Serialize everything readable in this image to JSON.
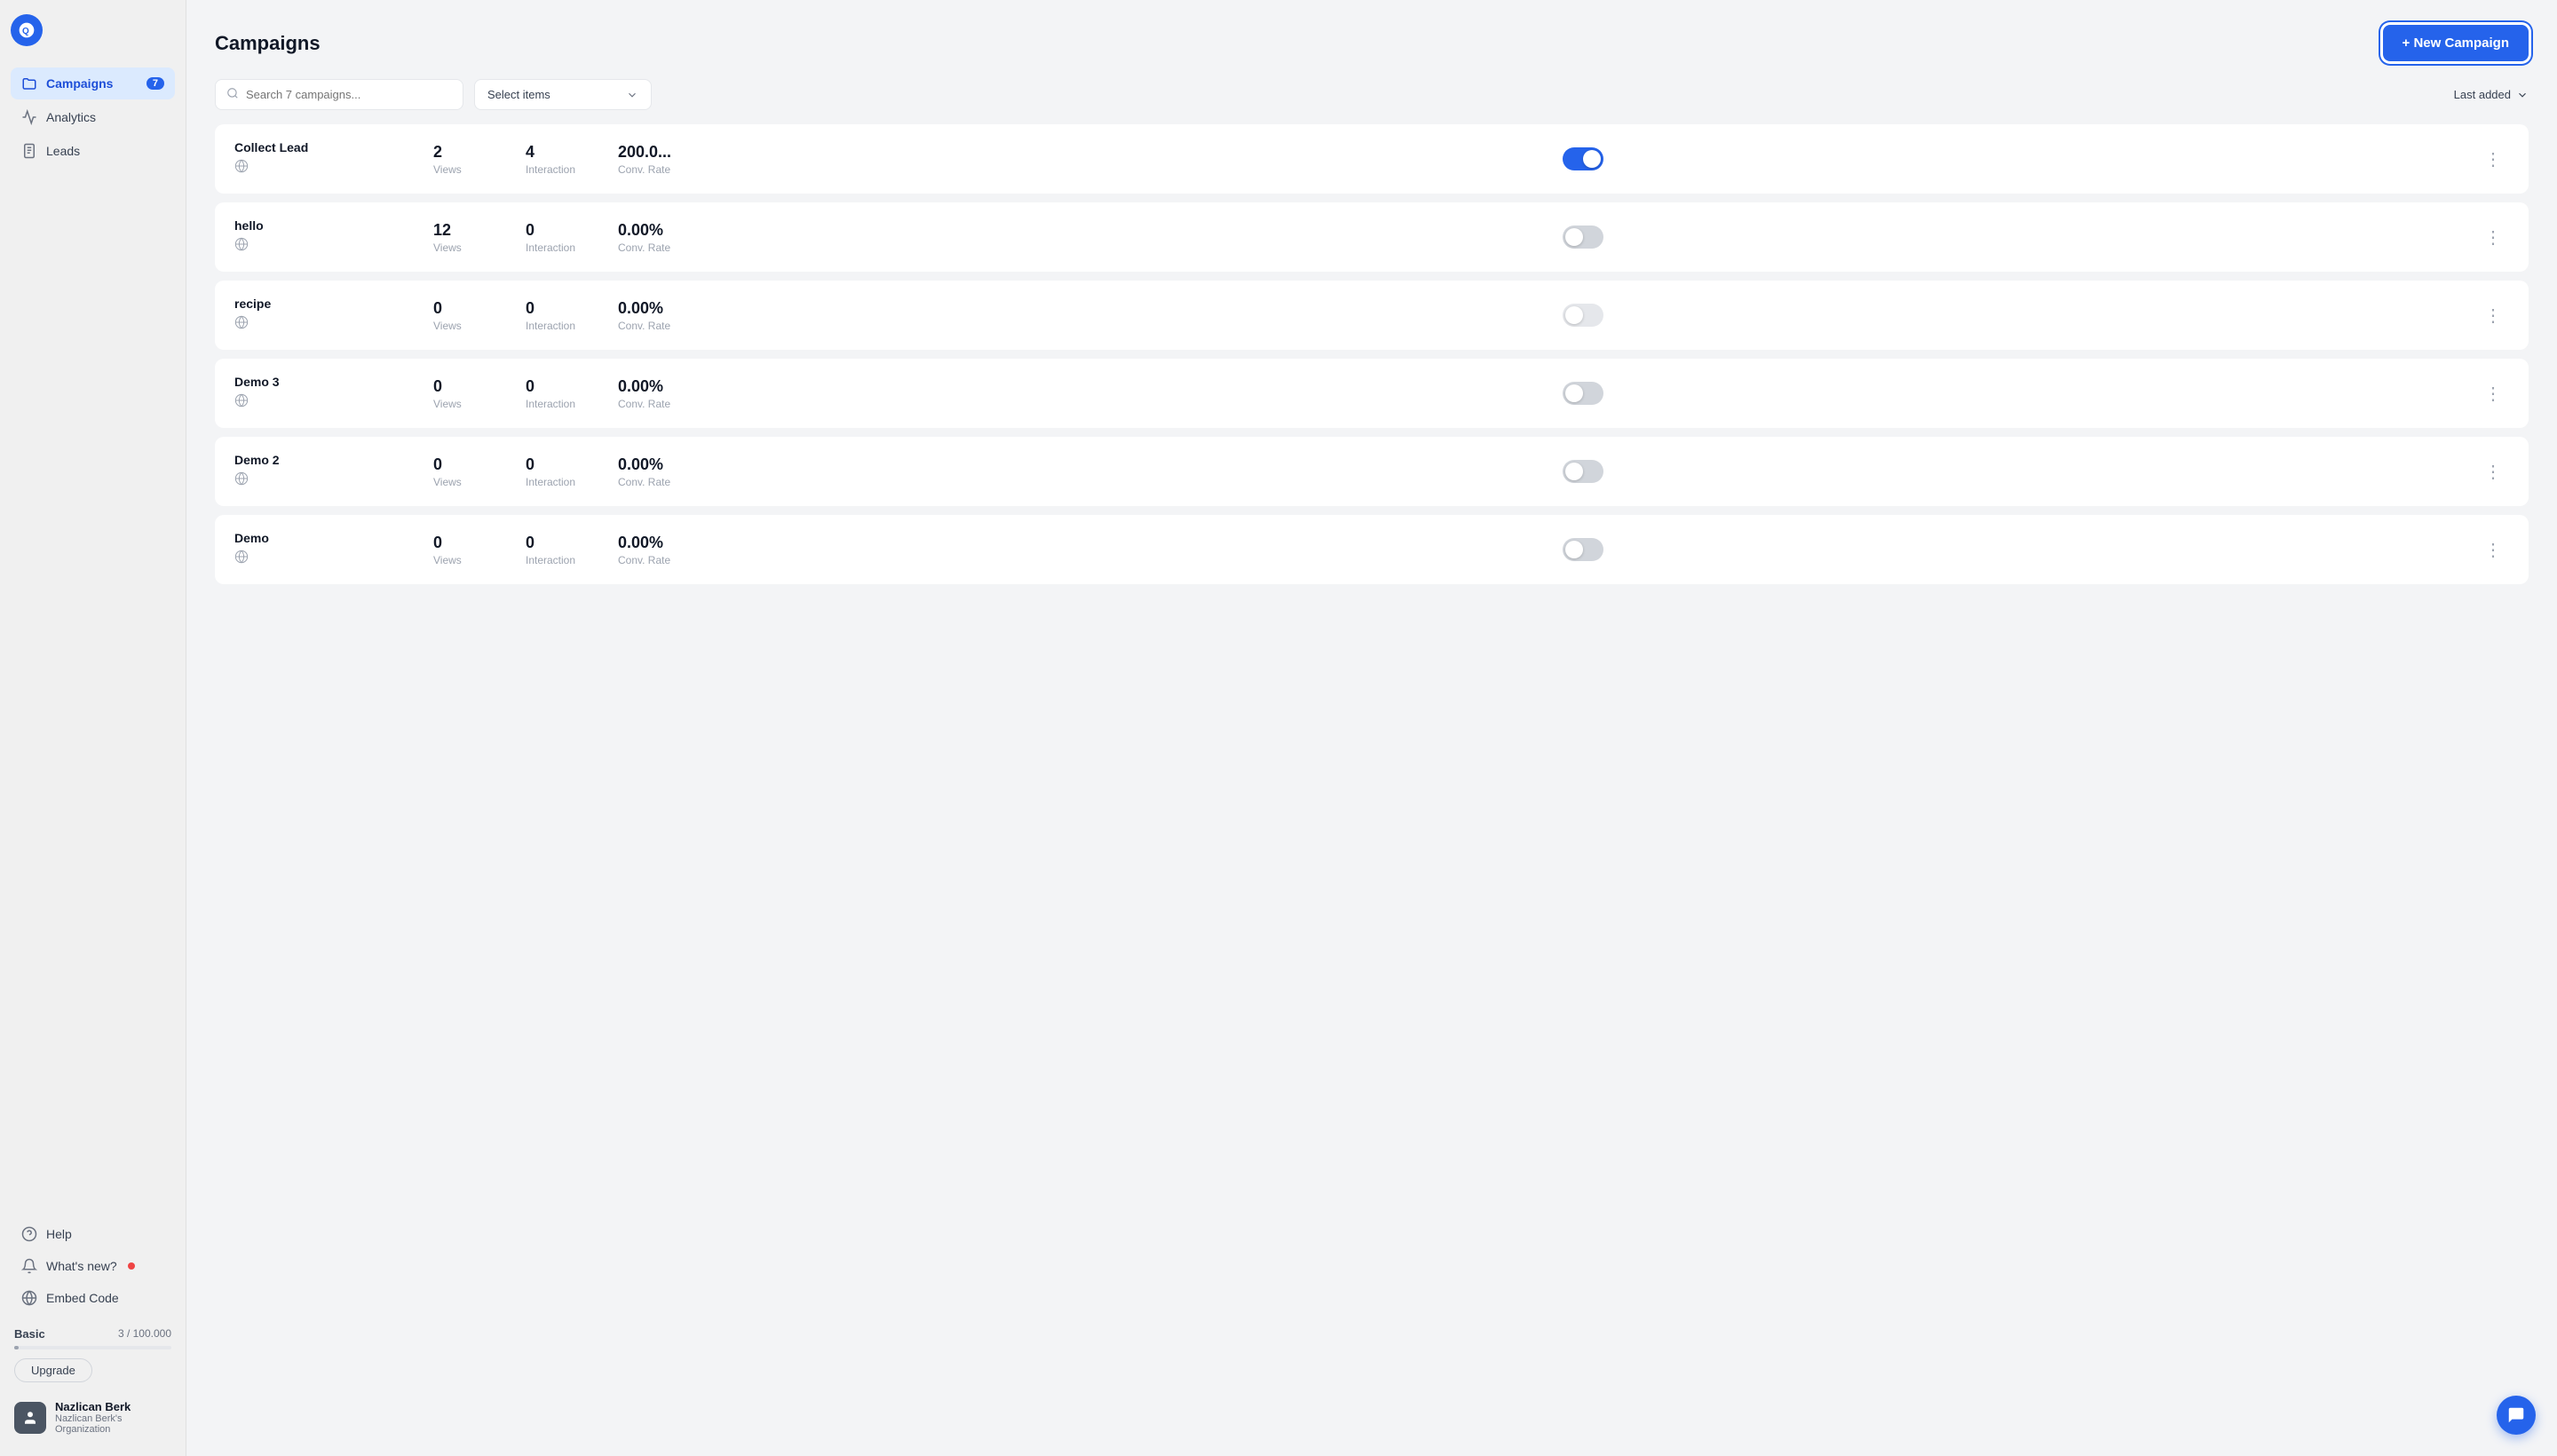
{
  "app": {
    "logo_label": "App Logo"
  },
  "sidebar": {
    "nav_items": [
      {
        "id": "campaigns",
        "label": "Campaigns",
        "badge": "7",
        "active": true,
        "icon": "folder"
      },
      {
        "id": "analytics",
        "label": "Analytics",
        "badge": null,
        "active": false,
        "icon": "chart"
      },
      {
        "id": "leads",
        "label": "Leads",
        "badge": null,
        "active": false,
        "icon": "file"
      }
    ],
    "bottom_items": [
      {
        "id": "help",
        "label": "Help",
        "icon": "help",
        "has_dot": false
      },
      {
        "id": "whats-new",
        "label": "What's new?",
        "icon": "bell",
        "has_dot": true
      },
      {
        "id": "embed-code",
        "label": "Embed Code",
        "icon": "code",
        "has_dot": false
      }
    ],
    "plan": {
      "label": "Basic",
      "usage": "3 / 100.000",
      "upgrade_label": "Upgrade"
    },
    "user": {
      "name": "Nazlican Berk",
      "org": "Nazlican Berk's Organization"
    }
  },
  "header": {
    "title": "Campaigns",
    "new_campaign_label": "+ New Campaign"
  },
  "toolbar": {
    "search_placeholder": "Search 7 campaigns...",
    "select_items_label": "Select items",
    "sort_label": "Last added"
  },
  "campaigns": [
    {
      "name": "Collect Lead",
      "views": "2",
      "interaction": "4",
      "conv_rate": "200.0...",
      "active": true,
      "disabled": false
    },
    {
      "name": "hello",
      "views": "12",
      "interaction": "0",
      "conv_rate": "0.00%",
      "active": false,
      "disabled": false
    },
    {
      "name": "recipe",
      "views": "0",
      "interaction": "0",
      "conv_rate": "0.00%",
      "active": false,
      "disabled": true
    },
    {
      "name": "Demo 3",
      "views": "0",
      "interaction": "0",
      "conv_rate": "0.00%",
      "active": false,
      "disabled": false
    },
    {
      "name": "Demo 2",
      "views": "0",
      "interaction": "0",
      "conv_rate": "0.00%",
      "active": false,
      "disabled": false
    },
    {
      "name": "Demo",
      "views": "0",
      "interaction": "0",
      "conv_rate": "0.00%",
      "active": false,
      "disabled": false
    }
  ],
  "stats_labels": {
    "views": "Views",
    "interaction": "Interaction",
    "conv_rate": "Conv. Rate"
  }
}
